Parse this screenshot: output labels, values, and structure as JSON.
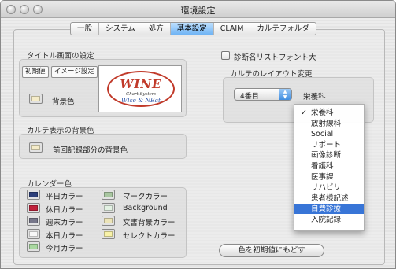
{
  "window": {
    "title": "環境設定"
  },
  "tabs": [
    "一般",
    "システム",
    "処方",
    "基本設定",
    "CLAIM",
    "カルテフォルダ"
  ],
  "active_tab": "基本設定",
  "title_screen": {
    "group_label": "タイトル画面の設定",
    "btn_initial": "初期値",
    "btn_image": "イメージ設定",
    "bg_label": "背景色",
    "bg_color": "#f5ecc9",
    "logo": {
      "main": "WINE",
      "sub1": "Chart System",
      "sub2": "WIse & NEat"
    }
  },
  "karte_bg": {
    "group_label": "カルテ表示の背景色",
    "label": "前回記録部分の背景色",
    "color": "#f5ecc9"
  },
  "calendar": {
    "group_label": "カレンダー色",
    "left": [
      {
        "label": "平日カラー",
        "color": "#2d3f7a"
      },
      {
        "label": "休日カラー",
        "color": "#c0213b"
      },
      {
        "label": "週末カラー",
        "color": "#77778a"
      },
      {
        "label": "本日カラー",
        "color": "#f7f7f7"
      },
      {
        "label": "今月カラー",
        "color": "#a9d8a0"
      }
    ],
    "right": [
      {
        "label": "マークカラー",
        "color": "#a8c6a0"
      },
      {
        "label": "Background",
        "color": "#e3f1e3"
      },
      {
        "label": "文書背景カラー",
        "color": "#ece4b8"
      },
      {
        "label": "セレクトカラー",
        "color": "#f8f2a8"
      }
    ]
  },
  "diag_font": {
    "label": "診断名リストフォント大",
    "checked": false
  },
  "layout": {
    "group_label": "カルテのレイアウト変更",
    "popup_value": "4番目",
    "current_label": "栄養科"
  },
  "menu": {
    "items": [
      "栄養科",
      "放射線科",
      "Social",
      "リポート",
      "画像診断",
      "看護科",
      "医事課",
      "リハビリ",
      "患者様記述",
      "自費診療",
      "入院記録"
    ],
    "checked": "栄養科",
    "highlighted": "自費診療"
  },
  "reset_button": "色を初期値にもどす"
}
